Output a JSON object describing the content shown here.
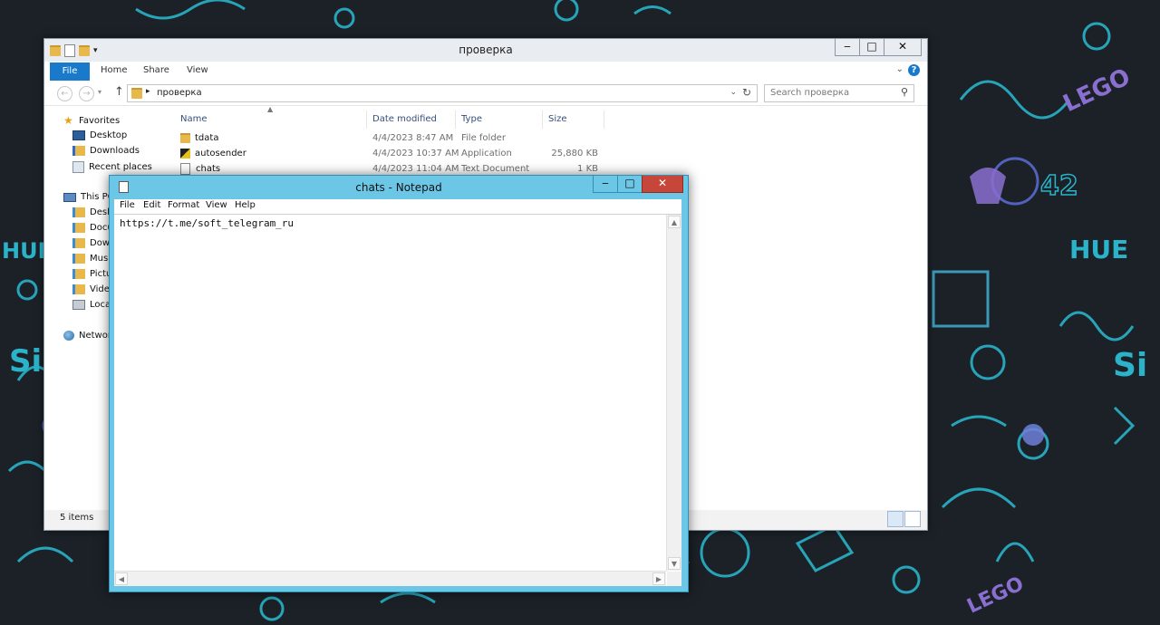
{
  "desktop": {
    "wallpaper_words": [
      "HUE",
      "HUE",
      "LEGO",
      "LEGO",
      "42",
      "Si",
      "Si"
    ]
  },
  "explorer": {
    "title": "проверка",
    "caption": {
      "minimize": "‒",
      "maximize": "□",
      "close": "✕"
    },
    "ribbon_tabs": [
      "File",
      "Home",
      "Share",
      "View"
    ],
    "help": "?",
    "address": {
      "path": "проверка"
    },
    "search_placeholder": "Search проверка",
    "navigation": {
      "favorites_label": "Favorites",
      "favorites": [
        "Desktop",
        "Downloads",
        "Recent places"
      ],
      "this_pc_label": "This PC",
      "this_pc_items": [
        "Deskt",
        "Docu",
        "Down",
        "Music",
        "Pictur",
        "Video",
        "Local"
      ],
      "network_label": "Networ"
    },
    "columns": [
      "Name",
      "Date modified",
      "Type",
      "Size"
    ],
    "files": [
      {
        "name": "tdata",
        "date": "4/4/2023 8:47 AM",
        "type": "File folder",
        "size": "",
        "icon": "folder-icon"
      },
      {
        "name": "autosender",
        "date": "4/4/2023 10:37 AM",
        "type": "Application",
        "size": "25,880 KB",
        "icon": "application-icon"
      },
      {
        "name": "chats",
        "date": "4/4/2023 11:04 AM",
        "type": "Text Document",
        "size": "1 KB",
        "icon": "text-document-icon"
      }
    ],
    "status": "5 items"
  },
  "notepad": {
    "title": "chats - Notepad",
    "caption": {
      "minimize": "‒",
      "maximize": "□",
      "close": "✕"
    },
    "menu": [
      "File",
      "Edit",
      "Format",
      "View",
      "Help"
    ],
    "content": "https://t.me/soft_telegram_ru"
  },
  "colors": {
    "accent": "#1979ca",
    "notepad_frame": "#6cc7e6",
    "close": "#c7463a"
  }
}
